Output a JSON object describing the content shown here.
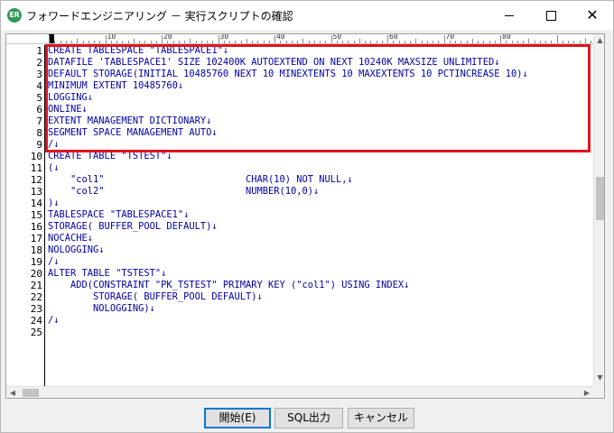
{
  "window": {
    "title": "フォワードエンジニアリング － 実行スクリプトの確認",
    "icon_label": "ER"
  },
  "ruler": {
    "labels": [
      "10",
      "20",
      "30",
      "40",
      "50",
      "60",
      "70",
      "80"
    ]
  },
  "editor": {
    "line_numbers": [
      "1",
      "2",
      "3",
      "4",
      "5",
      "6",
      "7",
      "8",
      "9",
      "10",
      "11",
      "12",
      "13",
      "14",
      "15",
      "16",
      "17",
      "18",
      "19",
      "20",
      "21",
      "22",
      "23",
      "24",
      "25"
    ],
    "lines": [
      "CREATE TABLESPACE \"TABLESPACE1\"↓",
      "DATAFILE 'TABLESPACE1' SIZE 102400K AUTOEXTEND ON NEXT 10240K MAXSIZE UNLIMITED↓",
      "DEFAULT STORAGE(INITIAL 10485760 NEXT 10 MINEXTENTS 10 MAXEXTENTS 10 PCTINCREASE 10)↓",
      "MINIMUM EXTENT 10485760↓",
      "LOGGING↓",
      "ONLINE↓",
      "EXTENT MANAGEMENT DICTIONARY↓",
      "SEGMENT SPACE MANAGEMENT AUTO↓",
      "/↓",
      "CREATE TABLE \"TSTEST\"↓",
      "(↓",
      "    \"col1\"                         CHAR(10) NOT NULL,↓",
      "    \"col2\"                         NUMBER(10,0)↓",
      ")↓",
      "TABLESPACE \"TABLESPACE1\"↓",
      "STORAGE( BUFFER_POOL DEFAULT)↓",
      "NOCACHE↓",
      "NOLOGGING↓",
      "/↓",
      "ALTER TABLE \"TSTEST\"↓",
      "    ADD(CONSTRAINT \"PK_TSTEST\" PRIMARY KEY (\"col1\") USING INDEX↓",
      "        STORAGE( BUFFER_POOL DEFAULT)↓",
      "        NOLOGGING)↓",
      "/↓",
      ""
    ],
    "highlight_color": "#e0141e",
    "text_color": "#0000a8"
  },
  "buttons": {
    "start": "開始(E)",
    "sql_output": "SQL出力",
    "cancel": "キャンセル"
  }
}
